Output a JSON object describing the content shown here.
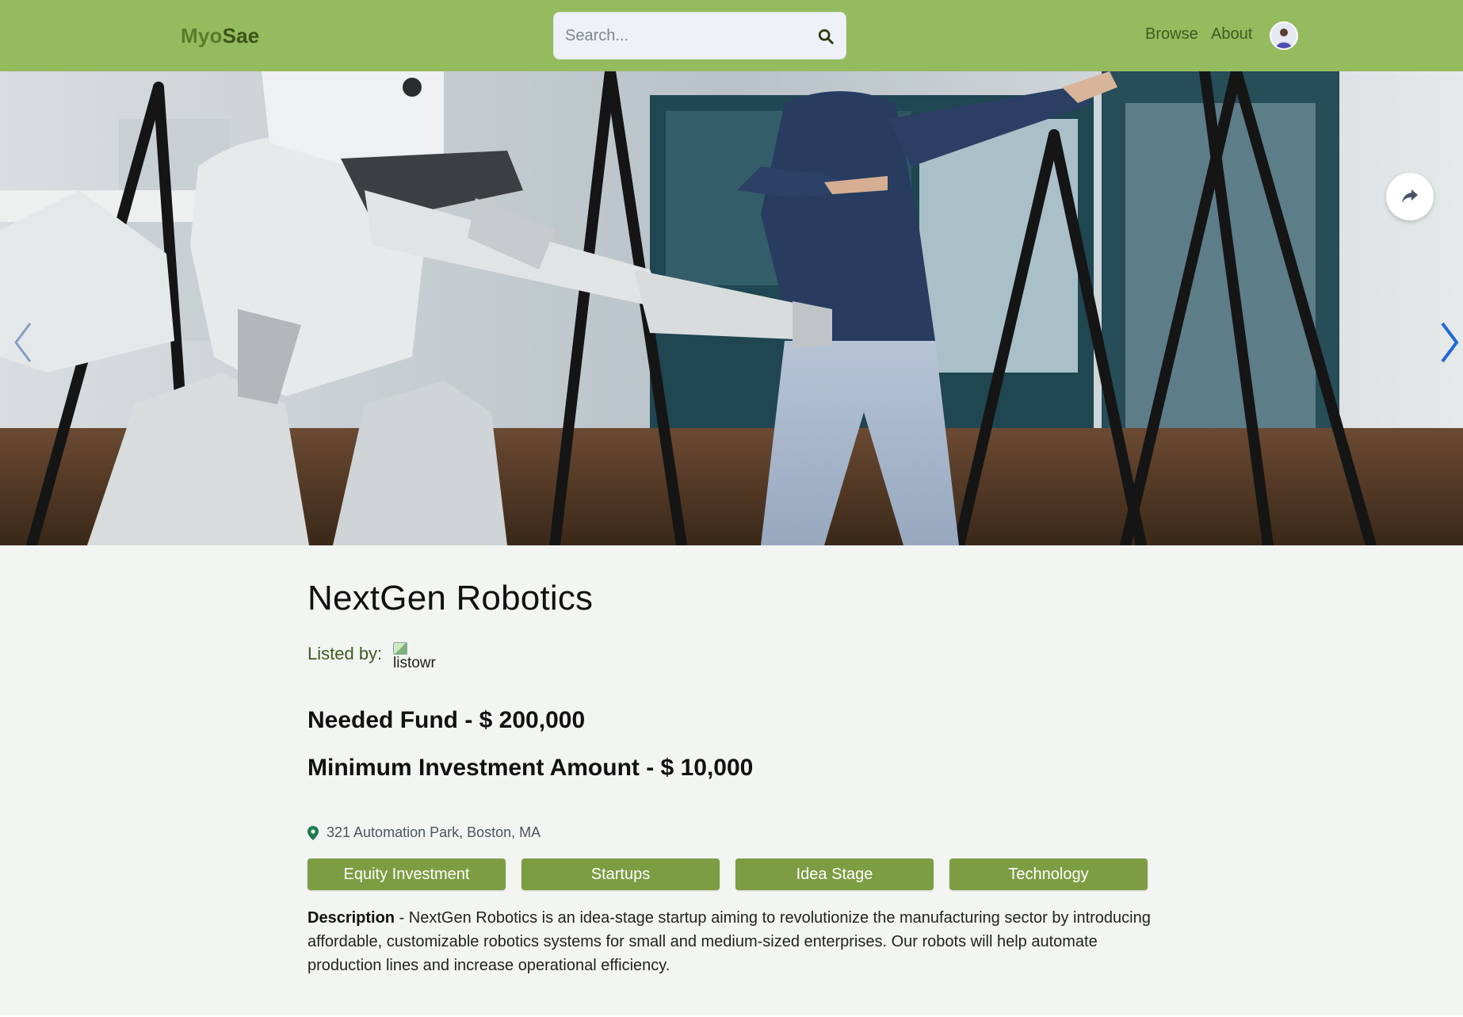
{
  "header": {
    "brand_part1": "Myo",
    "brand_part2": "Sae",
    "search_placeholder": "Search...",
    "nav": [
      "Browse",
      "About"
    ],
    "search_icon": "search-icon",
    "avatar_icon": "user-avatar"
  },
  "hero": {
    "image_alt": "Humanoid robot mimicking a woman's arm gestures in a lab",
    "share_icon": "share-icon",
    "prev_icon": "chevron-left-icon",
    "next_icon": "chevron-right-icon"
  },
  "listing": {
    "title": "NextGen Robotics",
    "listed_by_label": "Listed by:",
    "listed_by_alt": "listowr",
    "needed_fund": "Needed Fund - $ 200,000",
    "min_investment": "Minimum Investment Amount - $ 10,000",
    "location": "321 Automation Park, Boston, MA",
    "tags": [
      "Equity Investment",
      "Startups",
      "Idea Stage",
      "Technology"
    ],
    "description_label": "Description",
    "description_text": " - NextGen Robotics is an idea-stage startup aiming to revolutionize the manufacturing sector by introducing affordable, customizable robotics systems for small and medium-sized enterprises. Our robots will help automate production lines and increase operational efficiency."
  },
  "colors": {
    "header_bg": "#94bb5d",
    "tag_bg": "#7d9d43",
    "page_bg": "#f2f5f1"
  }
}
